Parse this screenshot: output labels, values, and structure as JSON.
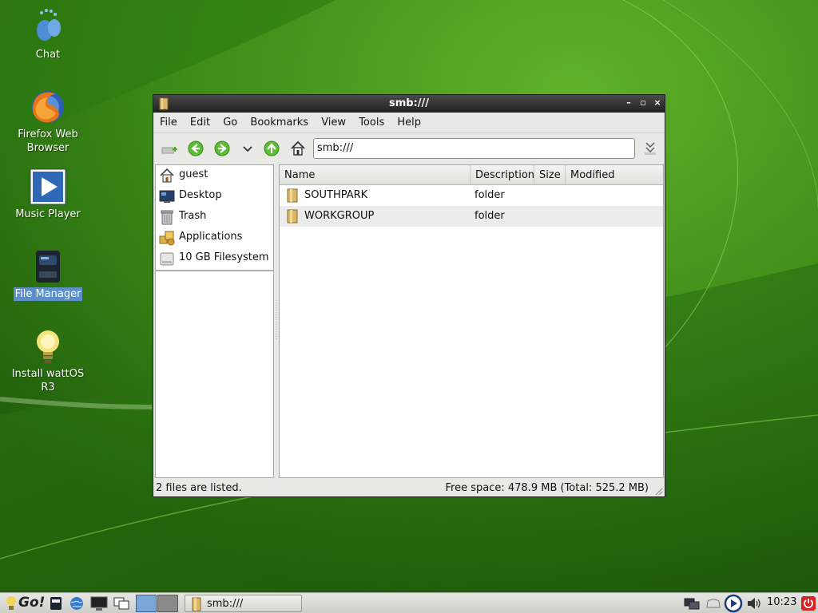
{
  "desktop": {
    "icons": [
      {
        "label": "Chat",
        "icon": "chat-icon"
      },
      {
        "label": "Firefox Web Browser",
        "icon": "firefox-icon"
      },
      {
        "label": "Music Player",
        "icon": "play-icon"
      },
      {
        "label": "File Manager",
        "icon": "file-manager-icon",
        "selected": true
      },
      {
        "label": "Install wattOS R3",
        "icon": "lightbulb-icon"
      }
    ]
  },
  "window": {
    "title": "smb:///",
    "menu": {
      "file": "File",
      "edit": "Edit",
      "go": "Go",
      "bookmarks": "Bookmarks",
      "view": "View",
      "tools": "Tools",
      "help": "Help"
    },
    "location": "smb:///",
    "sidebar": {
      "items": [
        {
          "label": "guest",
          "icon": "home-icon"
        },
        {
          "label": "Desktop",
          "icon": "desktop-icon"
        },
        {
          "label": "Trash",
          "icon": "trash-icon"
        },
        {
          "label": "Applications",
          "icon": "applications-icon"
        },
        {
          "label": "10 GB Filesystem",
          "icon": "drive-icon"
        }
      ]
    },
    "columns": {
      "name": "Name",
      "description": "Description",
      "size": "Size",
      "modified": "Modified"
    },
    "files": [
      {
        "name": "SOUTHPARK",
        "description": "folder"
      },
      {
        "name": "WORKGROUP",
        "description": "folder"
      }
    ],
    "status": {
      "left": "2 files are listed.",
      "right": "Free space: 478.9 MB (Total: 525.2 MB)"
    }
  },
  "taskbar": {
    "start_label": "Go!",
    "task_label": "smb:///",
    "clock": "10:23"
  },
  "colors": {
    "wallpaper_dark": "#1f5e0c",
    "wallpaper_light": "#5fb22a",
    "titlebar": "#2a2a2a",
    "selection": "#5a8fc8"
  }
}
